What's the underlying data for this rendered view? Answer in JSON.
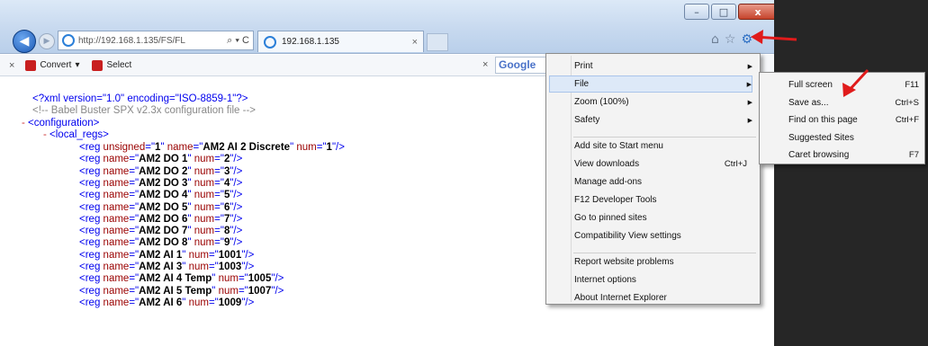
{
  "browser": {
    "address_text": "http://192.168.1.135/FS/FL",
    "address_icons": "⌕ ▾ C",
    "tab_title": "192.168.1.135",
    "tab_close": "×",
    "window_buttons": {
      "minimize": "–",
      "maximize": "□",
      "close": "x"
    }
  },
  "command_bar": {
    "close": "×",
    "convert_label": "Convert",
    "convert_caret": "▾",
    "select_label": "Select",
    "google_close": "×",
    "google_text": "Google"
  },
  "xml": {
    "decl": "<?xml version=\"1.0\" encoding=\"ISO-8859-1\"?>",
    "comment": "<!-- Babel Buster SPX v2.3x configuration file -->",
    "configuration_open": "<configuration>",
    "local_regs_open": "<local_regs>",
    "regs": [
      {
        "unsigned": "1",
        "name": "AM2 AI 2 Discrete",
        "num": "1"
      },
      {
        "name": "AM2 DO 1",
        "num": "2"
      },
      {
        "name": "AM2 DO 2",
        "num": "3"
      },
      {
        "name": "AM2 DO 3",
        "num": "4"
      },
      {
        "name": "AM2 DO 4",
        "num": "5"
      },
      {
        "name": "AM2 DO 5",
        "num": "6"
      },
      {
        "name": "AM2 DO 6",
        "num": "7"
      },
      {
        "name": "AM2 DO 7",
        "num": "8"
      },
      {
        "name": "AM2 DO 8",
        "num": "9"
      },
      {
        "name": "AM2 AI 1",
        "num": "1001"
      },
      {
        "name": "AM2 AI 3",
        "num": "1003"
      },
      {
        "name": "AM2 AI 4 Temp",
        "num": "1005"
      },
      {
        "name": "AM2 AI 5 Temp",
        "num": "1007"
      },
      {
        "name": "AM2 AI 6",
        "num": "1009"
      }
    ]
  },
  "tools_menu": {
    "items": [
      {
        "label": "Print",
        "has_arrow": true,
        "shortcut": ""
      },
      {
        "label": "File",
        "has_arrow": true,
        "shortcut": ""
      },
      {
        "label": "Zoom (100%)",
        "has_arrow": true,
        "shortcut": ""
      },
      {
        "label": "Safety",
        "has_arrow": true,
        "shortcut": ""
      },
      {
        "label": "Add site to Start menu",
        "has_arrow": false,
        "shortcut": ""
      },
      {
        "label": "View downloads",
        "has_arrow": false,
        "shortcut": "Ctrl+J"
      },
      {
        "label": "Manage add-ons",
        "has_arrow": false,
        "shortcut": ""
      },
      {
        "label": "F12 Developer Tools",
        "has_arrow": false,
        "shortcut": ""
      },
      {
        "label": "Go to pinned sites",
        "has_arrow": false,
        "shortcut": ""
      },
      {
        "label": "Compatibility View settings",
        "has_arrow": false,
        "shortcut": ""
      },
      {
        "label": "Report website problems",
        "has_arrow": false,
        "shortcut": ""
      },
      {
        "label": "Internet options",
        "has_arrow": false,
        "shortcut": ""
      },
      {
        "label": "About Internet Explorer",
        "has_arrow": false,
        "shortcut": ""
      }
    ],
    "arrow_glyph": "▶",
    "highlighted": "File"
  },
  "file_submenu": {
    "items": [
      {
        "label": "Full screen",
        "shortcut": "F11"
      },
      {
        "label": "Save as...",
        "shortcut": "Ctrl+S"
      },
      {
        "label": "Find on this page",
        "shortcut": "Ctrl+F"
      },
      {
        "label": "Suggested Sites",
        "shortcut": ""
      },
      {
        "label": "Caret browsing",
        "shortcut": "F7"
      }
    ]
  },
  "colors": {
    "annotation_arrow": "#e01b1b",
    "xml_tag": "#0000ee",
    "xml_attr": "#990000",
    "menu_highlight": "#dde9f8"
  }
}
